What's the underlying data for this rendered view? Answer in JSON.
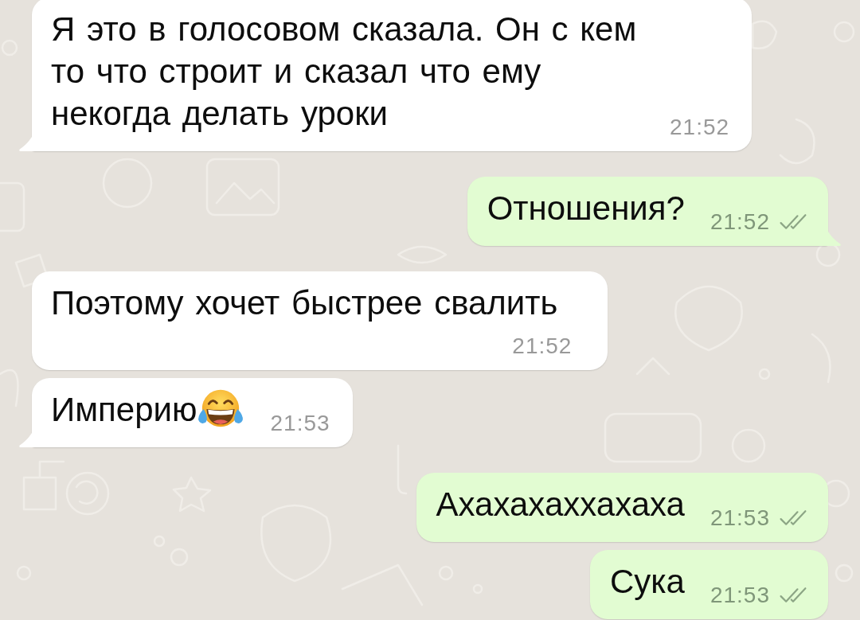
{
  "messages": [
    {
      "kind": "incoming",
      "text": "Я это в голосовом сказала. Он с кем то что строит и сказал что ему некогда делать уроки",
      "time": "21:52",
      "time_below": false,
      "tail": true
    },
    {
      "kind": "outgoing",
      "text": "Отношения?",
      "time": "21:52",
      "delivered": true,
      "read": false,
      "time_below": false,
      "tail": true
    },
    {
      "kind": "incoming",
      "text": "Поэтому хочет быстрее свалить",
      "time": "21:52",
      "time_below": true,
      "tail": false
    },
    {
      "kind": "incoming",
      "text": "Империю",
      "emoji": true,
      "time": "21:53",
      "time_below": false,
      "tail": true
    },
    {
      "kind": "outgoing",
      "text": "Ахахахаххахаха",
      "time": "21:53",
      "delivered": true,
      "read": false,
      "time_below": false,
      "tail": false
    },
    {
      "kind": "outgoing",
      "text": "Сука",
      "time": "21:53",
      "delivered": true,
      "read": false,
      "time_below": false,
      "tail": false
    }
  ]
}
